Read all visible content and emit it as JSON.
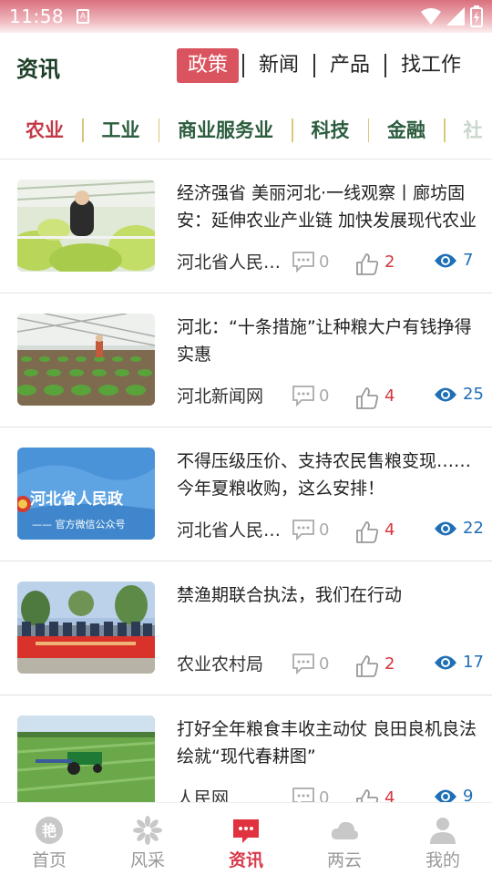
{
  "status_bar": {
    "time": "11:58",
    "sim_label": "A"
  },
  "header": {
    "title": "资讯",
    "tabs": [
      {
        "label": "政策",
        "active": true
      },
      {
        "label": "新闻",
        "active": false
      },
      {
        "label": "产品",
        "active": false
      },
      {
        "label": "找工作",
        "active": false
      }
    ]
  },
  "categories": [
    "农业",
    "工业",
    "商业服务业",
    "科技",
    "金融",
    "社"
  ],
  "articles": [
    {
      "title": "经济强省 美丽河北·一线观察丨廊坊固安：延伸农业产业链 加快发展现代农业",
      "source": "河北省人民政府",
      "comments": "0",
      "likes": "2",
      "views": "7",
      "thumb": "greenhouse-lettuce"
    },
    {
      "title": "河北：“十条措施”让种粮大户有钱挣得实惠",
      "source": "河北新闻网",
      "comments": "0",
      "likes": "4",
      "views": "25",
      "thumb": "greenhouse-seedlings"
    },
    {
      "title": "不得压级压价、支持农民售粮变现……今年夏粮收购，这么安排！",
      "source": "河北省人民政府",
      "comments": "0",
      "likes": "4",
      "views": "22",
      "thumb": "gov-wechat-banner",
      "thumb_text": "河北省人民政",
      "thumb_subtext": "—— 官方微信公众号"
    },
    {
      "title": "禁渔期联合执法，我们在行动",
      "source": "农业农村局",
      "comments": "0",
      "likes": "2",
      "views": "17",
      "thumb": "group-photo-banner"
    },
    {
      "title": "打好全年粮食丰收主动仗 良田良机良法绘就“现代春耕图”",
      "source": "人民网",
      "comments": "0",
      "likes": "4",
      "views": "9",
      "thumb": "tractor-field"
    }
  ],
  "bottom_nav": [
    {
      "label": "首页",
      "icon": "home-logo-icon",
      "active": false
    },
    {
      "label": "风采",
      "icon": "flower-icon",
      "active": false
    },
    {
      "label": "资讯",
      "icon": "chat-bubble-icon",
      "active": true
    },
    {
      "label": "两云",
      "icon": "cloud-icon",
      "active": false
    },
    {
      "label": "我的",
      "icon": "user-icon",
      "active": false
    }
  ],
  "colors": {
    "accent": "#d9545f",
    "category_active": "#c23a48",
    "category": "#2c5d3f",
    "likes": "#d5373f",
    "views": "#1f6fb6",
    "nav_active": "#d9394a"
  }
}
